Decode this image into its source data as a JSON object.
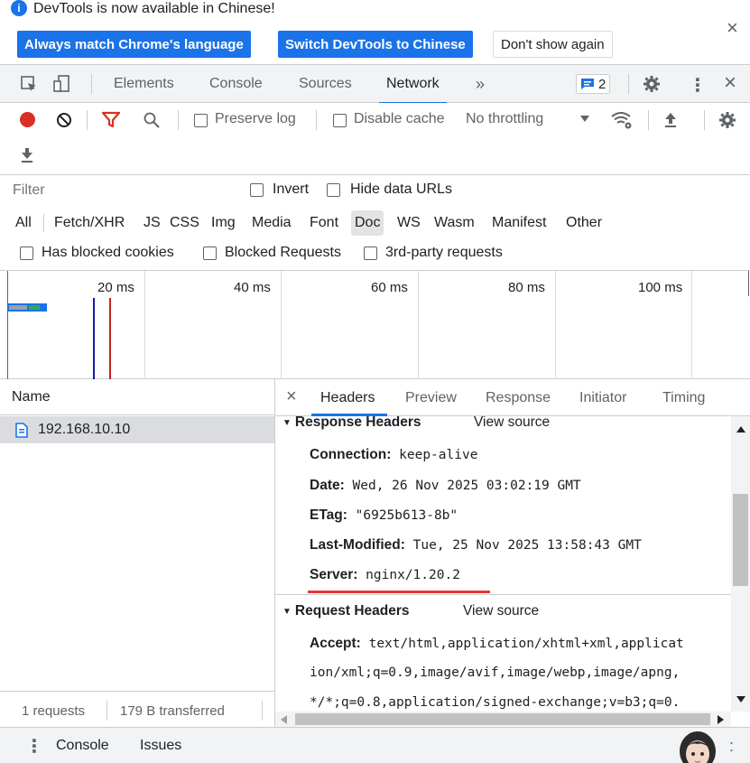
{
  "infobar": {
    "message": "DevTools is now available in Chinese!",
    "info_icon_glyph": "i",
    "btn_match_language": "Always match Chrome's language",
    "btn_switch_chinese": "Switch DevTools to Chinese",
    "btn_dont_show": "Don't show again",
    "close_glyph": "×"
  },
  "tabs": {
    "elements": "Elements",
    "console": "Console",
    "sources": "Sources",
    "network": "Network",
    "more": "»",
    "issues_badge": "2",
    "close": "×"
  },
  "toolbar": {
    "preserve_log": "Preserve log",
    "disable_cache": "Disable cache",
    "throttling": "No throttling"
  },
  "filters": {
    "filter_placeholder": "Filter",
    "invert": "Invert",
    "hide_data_urls": "Hide data URLs",
    "types": [
      "All",
      "Fetch/XHR",
      "JS",
      "CSS",
      "Img",
      "Media",
      "Font",
      "Doc",
      "WS",
      "Wasm",
      "Manifest",
      "Other"
    ],
    "selected_type": "Doc",
    "has_blocked_cookies": "Has blocked cookies",
    "blocked_requests": "Blocked Requests",
    "third_party": "3rd-party requests"
  },
  "overview": {
    "ticks": [
      "20 ms",
      "40 ms",
      "60 ms",
      "80 ms",
      "100 ms"
    ]
  },
  "request_list": {
    "column_name": "Name",
    "rows": [
      "192.168.10.10"
    ]
  },
  "details": {
    "close": "×",
    "tabs": [
      "Headers",
      "Preview",
      "Response",
      "Initiator",
      "Timing"
    ],
    "active_tab": "Headers",
    "response_headers_title": "Response Headers",
    "request_headers_title": "Request Headers",
    "view_source": "View source",
    "response_headers": [
      {
        "name": "Connection:",
        "value": "keep-alive"
      },
      {
        "name": "Date:",
        "value": "Wed, 26 Nov 2025 03:02:19 GMT"
      },
      {
        "name": "ETag:",
        "value": "\"6925b613-8b\""
      },
      {
        "name": "Last-Modified:",
        "value": "Tue, 25 Nov 2025 13:58:43 GMT"
      },
      {
        "name": "Server:",
        "value": "nginx/1.20.2"
      }
    ],
    "request_accept_name": "Accept:",
    "request_accept_lines": [
      "text/html,application/xhtml+xml,applicat",
      "ion/xml;q=0.9,image/avif,image/webp,image/apng,",
      "*/*;q=0.8,application/signed-exchange;v=b3;q=0."
    ]
  },
  "status": {
    "requests": "1 requests",
    "transferred": "179 B transferred"
  },
  "drawer": {
    "menu_glyph": "⋮",
    "console": "Console",
    "issues": "Issues"
  },
  "colors": {
    "accent": "#1a73e8",
    "record_red": "#d93025",
    "highlight_underline": "#e53935",
    "dom_content_loaded_line": "#1a1aa6",
    "load_line": "#c5221f"
  }
}
